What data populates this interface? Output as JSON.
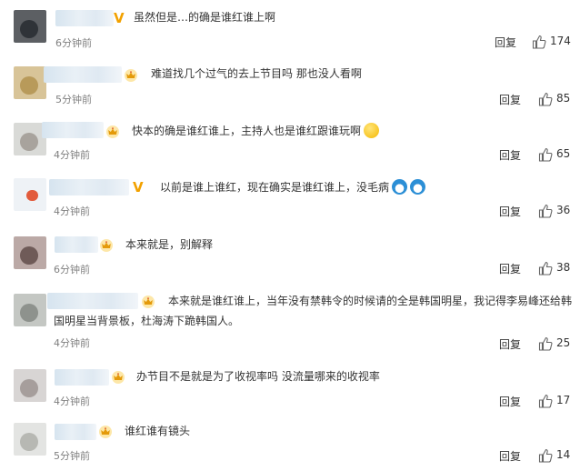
{
  "comments": [
    {
      "text": "虽然但是…的确是谁红谁上啊",
      "time": "6分钟前",
      "reply": "回复",
      "likes": "174",
      "badge": "v-icon"
    },
    {
      "text": "难道找几个过气的去上节目吗 那也没人看啊",
      "time": "5分钟前",
      "reply": "回复",
      "likes": "85",
      "badge": "crown-icon"
    },
    {
      "text": "快本的确是谁红谁上，主持人也是谁红跟谁玩啊",
      "time": "4分钟前",
      "reply": "回复",
      "likes": "65",
      "badge": "crown-icon"
    },
    {
      "text": "以前是谁上谁红，现在确实是谁红谁上，没毛病",
      "time": "4分钟前",
      "reply": "回复",
      "likes": "36",
      "badge": "v-icon"
    },
    {
      "text": "本来就是，别解释",
      "time": "6分钟前",
      "reply": "回复",
      "likes": "38",
      "badge": "crown-icon"
    },
    {
      "text": "本来就是谁红谁上，当年没有禁韩令的时候请的全是韩国明星，我记得李易峰还给韩",
      "text2": "国明星当背景板，杜海涛下跪韩国人。",
      "time": "4分钟前",
      "reply": "回复",
      "likes": "25",
      "badge": "crown-icon"
    },
    {
      "text": "办节目不是就是为了收视率吗 没流量哪来的收视率",
      "time": "4分钟前",
      "reply": "回复",
      "likes": "17",
      "badge": "crown-icon"
    },
    {
      "text": "谁红谁有镜头",
      "time": "5分钟前",
      "reply": "回复",
      "likes": "14",
      "badge": "crown-icon"
    }
  ]
}
